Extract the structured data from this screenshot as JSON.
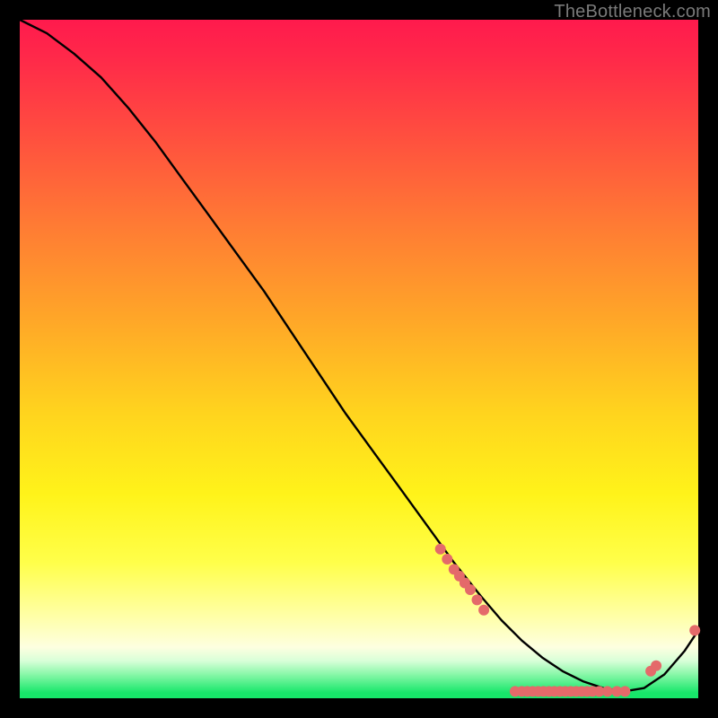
{
  "watermark": {
    "text": "TheBottleneck.com"
  },
  "chart_data": {
    "type": "line",
    "title": "",
    "xlabel": "",
    "ylabel": "",
    "xlim": [
      0,
      100
    ],
    "ylim": [
      0,
      100
    ],
    "grid": false,
    "legend": false,
    "background_gradient_stops": [
      {
        "pct": 0,
        "color": "#ff1a4d"
      },
      {
        "pct": 16,
        "color": "#ff4b40"
      },
      {
        "pct": 44,
        "color": "#ffa628"
      },
      {
        "pct": 70,
        "color": "#fff31a"
      },
      {
        "pct": 88,
        "color": "#ffffa8"
      },
      {
        "pct": 94.5,
        "color": "#d8ffd8"
      },
      {
        "pct": 99.2,
        "color": "#17e76a"
      }
    ],
    "series": [
      {
        "name": "bottleneck-curve",
        "color": "#000000",
        "x": [
          0,
          4,
          8,
          12,
          16,
          20,
          24,
          28,
          32,
          36,
          40,
          44,
          48,
          52,
          56,
          60,
          64,
          68,
          71,
          74,
          77,
          80,
          83,
          86,
          89,
          92,
          95,
          98,
          100
        ],
        "y": [
          100,
          98,
          95,
          91.5,
          87,
          82,
          76.5,
          71,
          65.5,
          60,
          54,
          48,
          42,
          36.5,
          31,
          25.5,
          20,
          15,
          11.5,
          8.5,
          6,
          4,
          2.5,
          1.5,
          1,
          1.5,
          3.5,
          7,
          10
        ]
      }
    ],
    "markers": {
      "name": "data-points",
      "color": "#e46a6a",
      "radius_px": 6,
      "points": [
        {
          "x": 62.0,
          "y": 22.0
        },
        {
          "x": 63.0,
          "y": 20.5
        },
        {
          "x": 64.0,
          "y": 19.0
        },
        {
          "x": 64.8,
          "y": 18.0
        },
        {
          "x": 65.6,
          "y": 17.0
        },
        {
          "x": 66.4,
          "y": 16.0
        },
        {
          "x": 67.4,
          "y": 14.5
        },
        {
          "x": 68.4,
          "y": 13.0
        },
        {
          "x": 73.0,
          "y": 1.0
        },
        {
          "x": 74.0,
          "y": 1.0
        },
        {
          "x": 74.8,
          "y": 1.0
        },
        {
          "x": 75.6,
          "y": 1.0
        },
        {
          "x": 76.4,
          "y": 1.0
        },
        {
          "x": 77.2,
          "y": 1.0
        },
        {
          "x": 78.0,
          "y": 1.0
        },
        {
          "x": 78.8,
          "y": 1.0
        },
        {
          "x": 79.6,
          "y": 1.0
        },
        {
          "x": 80.4,
          "y": 1.0
        },
        {
          "x": 81.2,
          "y": 1.0
        },
        {
          "x": 82.0,
          "y": 1.0
        },
        {
          "x": 82.8,
          "y": 1.0
        },
        {
          "x": 83.6,
          "y": 1.0
        },
        {
          "x": 84.4,
          "y": 1.0
        },
        {
          "x": 85.4,
          "y": 1.0
        },
        {
          "x": 86.6,
          "y": 1.0
        },
        {
          "x": 88.0,
          "y": 1.0
        },
        {
          "x": 89.2,
          "y": 1.0
        },
        {
          "x": 93.0,
          "y": 4.0
        },
        {
          "x": 93.8,
          "y": 4.8
        },
        {
          "x": 99.5,
          "y": 10.0
        }
      ]
    }
  }
}
